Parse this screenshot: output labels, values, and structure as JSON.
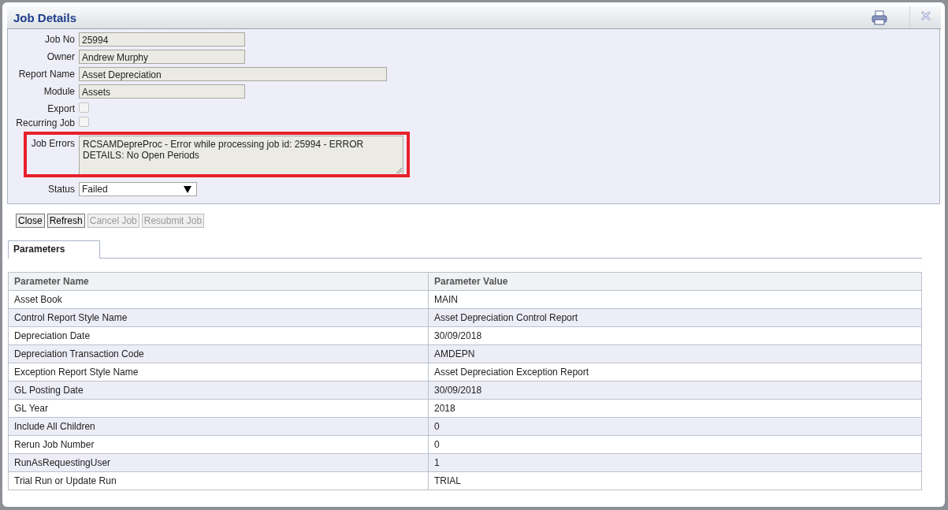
{
  "window": {
    "title": "Job Details"
  },
  "form": {
    "fields": [
      {
        "kind": "text",
        "label": "Job No",
        "value": "25994"
      },
      {
        "kind": "text",
        "label": "Owner",
        "value": "Andrew Murphy"
      },
      {
        "kind": "text",
        "label": "Report Name",
        "value": "Asset Depreciation"
      },
      {
        "kind": "text",
        "label": "Module",
        "value": "Assets"
      },
      {
        "kind": "checkbox",
        "label": "Export",
        "checked": false
      },
      {
        "kind": "checkbox",
        "label": "Recurring Job",
        "checked": false
      },
      {
        "kind": "textarea",
        "label": "Job Errors",
        "value": "RCSAMDepreProc - Error while processing job id: 25994 - ERROR DETAILS: No Open Periods",
        "highlighted": true
      },
      {
        "kind": "select",
        "label": "Status",
        "value": "Failed"
      }
    ]
  },
  "buttons": [
    {
      "label": "Close",
      "disabled": false
    },
    {
      "label": "Refresh",
      "disabled": false
    },
    {
      "label": "Cancel Job",
      "disabled": true
    },
    {
      "label": "Resubmit Job",
      "disabled": true
    }
  ],
  "tabs": [
    {
      "label": "Parameters",
      "selected": true
    }
  ],
  "table": {
    "columns": [
      "Parameter Name",
      "Parameter Value"
    ],
    "rows": [
      [
        "Asset Book",
        "MAIN"
      ],
      [
        "Control Report Style Name",
        "Asset Depreciation Control Report"
      ],
      [
        "Depreciation Date",
        "30/09/2018"
      ],
      [
        "Depreciation Transaction Code",
        "AMDEPN"
      ],
      [
        "Exception Report Style Name",
        "Asset Depreciation Exception Report"
      ],
      [
        "GL Posting Date",
        "30/09/2018"
      ],
      [
        "GL Year",
        "2018"
      ],
      [
        "Include All Children",
        "0"
      ],
      [
        "Rerun Job Number",
        "0"
      ],
      [
        "RunAsRequestingUser",
        "1"
      ],
      [
        "Trial Run or Update Run",
        "TRIAL"
      ]
    ]
  }
}
